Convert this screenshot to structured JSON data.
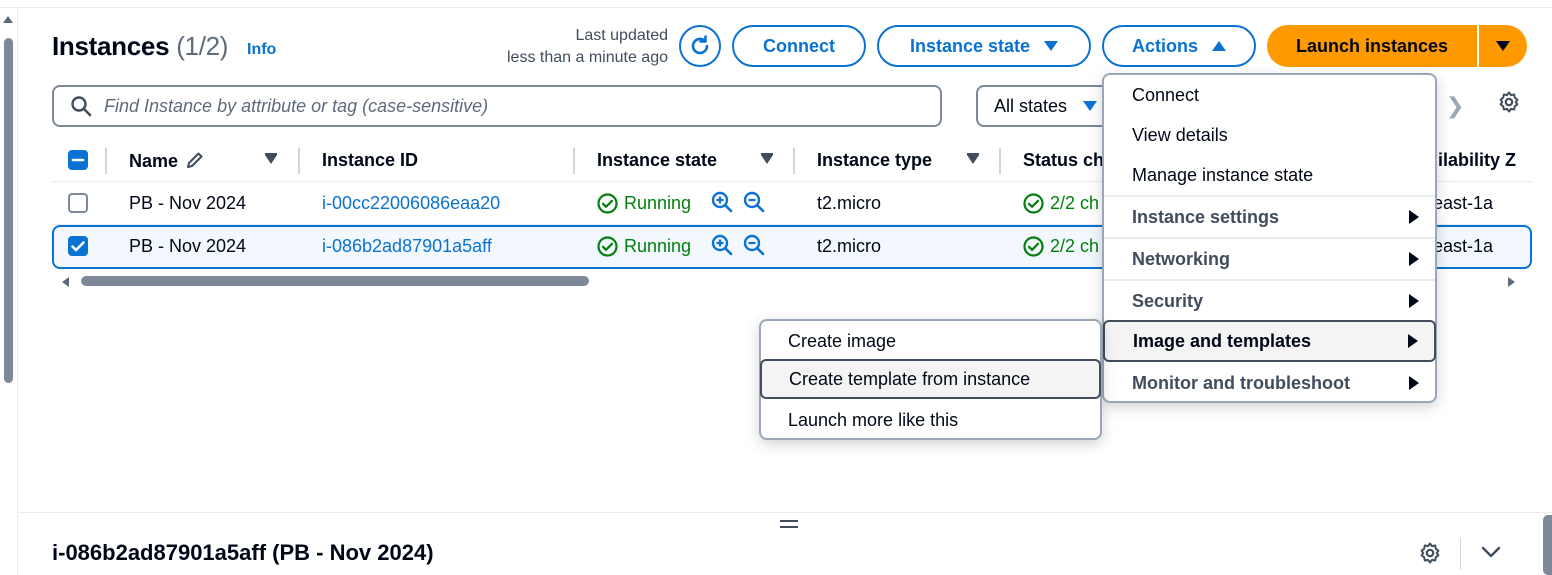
{
  "header": {
    "title": "Instances",
    "count": "(1/2)",
    "info": "Info",
    "last_updated_line1": "Last updated",
    "last_updated_line2": "less than a minute ago",
    "connect_label": "Connect",
    "instance_state_label": "Instance state",
    "actions_label": "Actions",
    "launch_label": "Launch instances"
  },
  "filter": {
    "search_placeholder": "Find Instance by attribute or tag (case-sensitive)",
    "states_value": "All states"
  },
  "table": {
    "columns": [
      "Name",
      "Instance ID",
      "Instance state",
      "Instance type",
      "Status ch",
      "ilability Z"
    ],
    "rows": [
      {
        "name": "PB - Nov 2024",
        "id": "i-00cc22006086eaa20",
        "state": "Running",
        "type": "t2.micro",
        "status": "2/2 ch",
        "az": "east-1a",
        "selected": false
      },
      {
        "name": "PB - Nov 2024",
        "id": "i-086b2ad87901a5aff",
        "state": "Running",
        "type": "t2.micro",
        "status": "2/2 ch",
        "az": "east-1a",
        "selected": true
      }
    ]
  },
  "actions_menu": {
    "items": [
      "Connect",
      "View details",
      "Manage instance state"
    ],
    "groups": [
      "Instance settings",
      "Networking",
      "Security",
      "Image and templates",
      "Monitor and troubleshoot"
    ],
    "active_group": "Image and templates"
  },
  "submenu": {
    "items": [
      "Create image",
      "Create template from instance",
      "Launch more like this"
    ],
    "active_item": "Create template from instance"
  },
  "detail": {
    "title": "i-086b2ad87901a5aff (PB - Nov 2024)"
  },
  "colors": {
    "link": "#0972d3",
    "primary": "#ff9900",
    "success": "#037f0c",
    "text": "#000716"
  }
}
